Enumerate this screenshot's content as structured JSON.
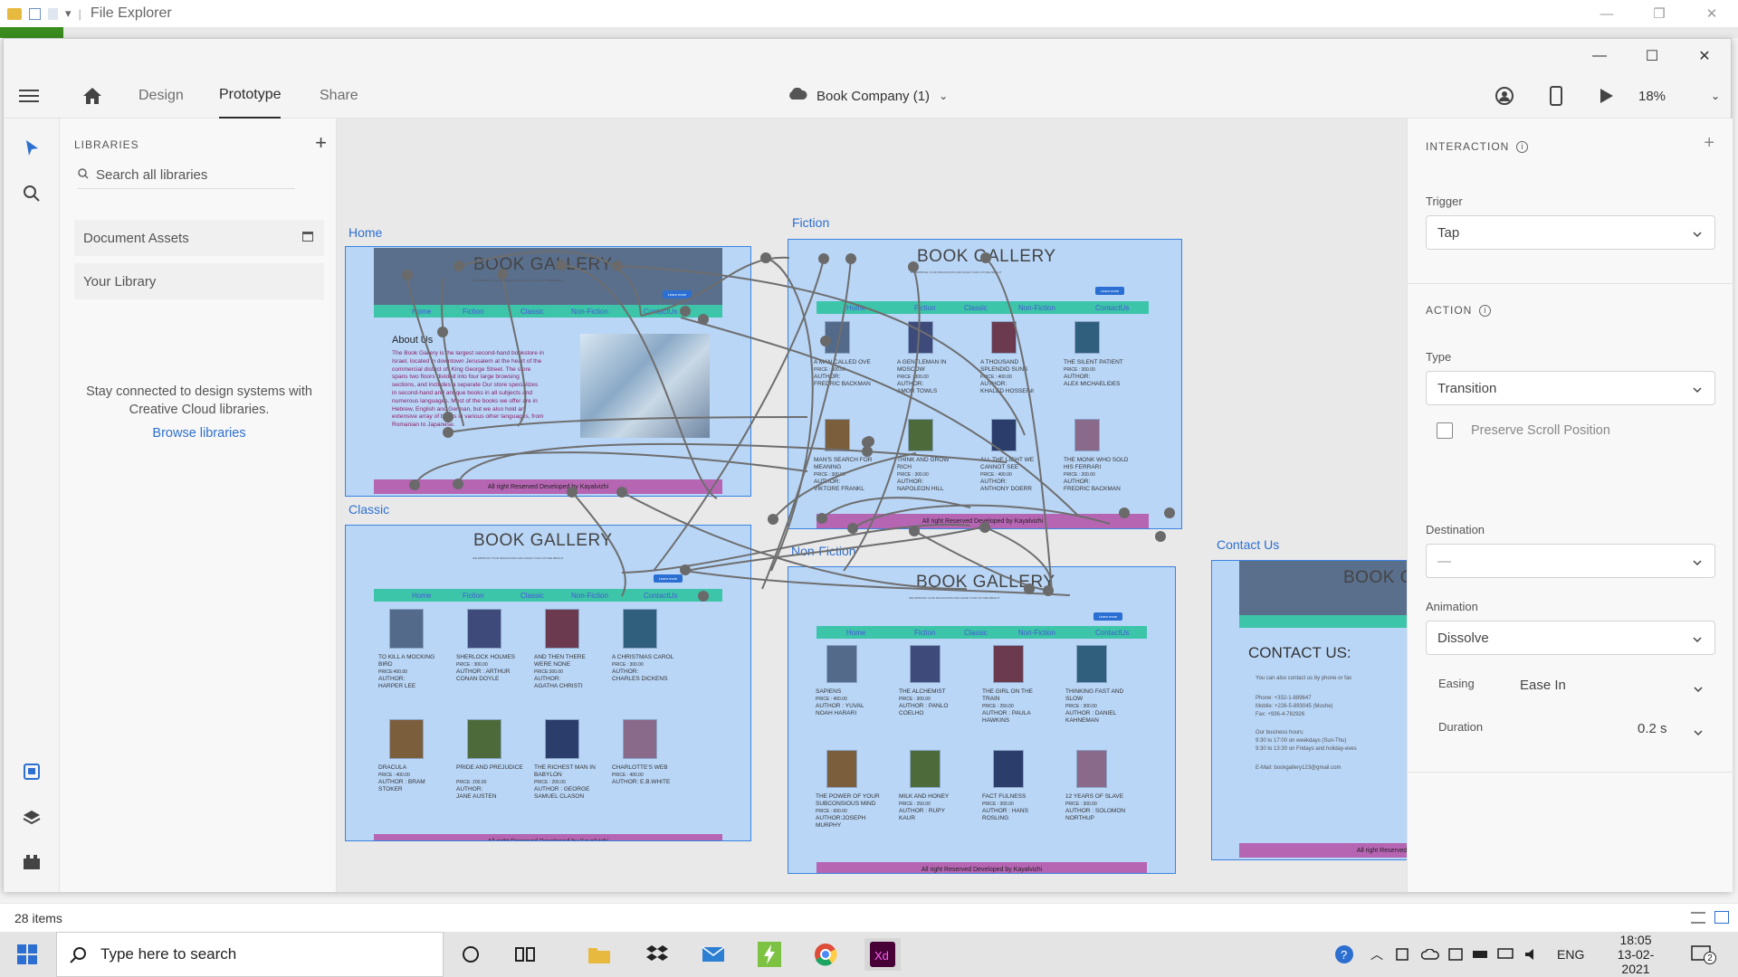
{
  "file_explorer": {
    "title": "File Explorer"
  },
  "xd": {
    "tabs": [
      "Design",
      "Prototype",
      "Share"
    ],
    "active_tab": "Prototype",
    "doc_title": "Book Company (1)",
    "zoom": "18%"
  },
  "libraries": {
    "header": "LIBRARIES",
    "search_placeholder": "Search all libraries",
    "items": [
      "Document Assets",
      "Your Library"
    ],
    "message": "Stay connected to design systems with Creative Cloud libraries.",
    "link": "Browse libraries"
  },
  "canvas": {
    "artboards": {
      "home": "Home",
      "fiction": "Fiction",
      "classic": "Classic",
      "nonfiction": "Non-Fiction",
      "contact": "Contact Us"
    },
    "gallery_title": "BOOK GALLERY",
    "tagline": "WE IMPROVE YOUR IMAGINATION AND MAKE YOUR FUTURE BRIGHT",
    "learn_more": "Learn more",
    "nav": [
      "Home",
      "Fiction",
      "Classic",
      "Non-Fiction",
      "ContactUs"
    ],
    "footer": "All right Reserved Developed by Kayalvizhi",
    "about_title": "About Us",
    "about_text": "The Book Gallery is the largest second-hand bookstore in Israel, located in downtown Jerusalem at the heart of the commercial district off King George Street. The store spans two floors divided into four large browsing sections, and includes a separate Our store specializes in second-hand and antique books in all subjects and numerous languages. Most of the books we offer are in Hebrew, English and German, but we also hold an extensive array of books in various other languages, from Romanian to Japanese.",
    "fiction_books": [
      {
        "title": "A MAN CALLED OVE",
        "price": "PRICE : 300.00",
        "author": "AUTHOR:",
        "name": "FREDRIC BACKMAN"
      },
      {
        "title": "A GENTLEMAN IN MOSCOW",
        "price": "PRICE : 300.00",
        "author": "AUTHOR:",
        "name": "AMOR TOWLS"
      },
      {
        "title": "A THOUSAND SPLENDID SUNS",
        "price": "PRICE : 400.00",
        "author": "AUTHOR:",
        "name": "KHALED HOSSEINI"
      },
      {
        "title": "THE SILENT PATIENT",
        "price": "PRICE : 300.00",
        "author": "AUTHOR:",
        "name": "ALEX MICHAELIDES"
      },
      {
        "title": "MAN'S SEARCH FOR MEANING",
        "price": "PRICE : 300.00",
        "author": "AUTHOR:",
        "name": "VIKTORE FRANKL"
      },
      {
        "title": "THINK AND GROW RICH",
        "price": "PRICE : 300.00",
        "author": "AUTHOR:",
        "name": "NAPOLEON HILL"
      },
      {
        "title": "ALL THE LIGHT WE CANNOT SEE",
        "price": "PRICE : 400.00",
        "author": "AUTHOR:",
        "name": "ANTHONY DOERR"
      },
      {
        "title": "THE MONK WHO SOLD HIS FERRARI",
        "price": "PRICE : 200.00",
        "author": "AUTHOR:",
        "name": "FREDRIC BACKMAN"
      }
    ],
    "classic_books": [
      {
        "title": "TO KILL A MOCKING BIRD",
        "price": "PRICE:400.00",
        "author": "AUTHOR:",
        "name": "HARPER LEE"
      },
      {
        "title": "SHERLOCK HOLMES",
        "price": "PRICE : 300.00",
        "author": "AUTHOR : ARTHUR",
        "name": "CONAN DOYLE"
      },
      {
        "title": "AND THEN THERE WERE NONE",
        "price": "PRICE:300.00",
        "author": "AUTHOR:",
        "name": "AGATHA CHRISTI"
      },
      {
        "title": "A CHRISTMAS CAROL",
        "price": "PRICE : 300.00",
        "author": "AUTHOR:",
        "name": "CHARLES DICKENS"
      },
      {
        "title": "DRACULA",
        "price": "PRICE : 400.00",
        "author": "AUTHOR : BRAM",
        "name": "STOKER"
      },
      {
        "title": "PRIDE AND PREJUDICE",
        "price": "PRICE: 200.00",
        "author": "AUTHOR:",
        "name": "JANE AUSTEN"
      },
      {
        "title": "THE RICHEST MAN IN BABYLON",
        "price": "PRICE : 200.00",
        "author": "AUTHOR : GEORGE",
        "name": "SAMUEL CLASON"
      },
      {
        "title": "CHARLOTTE'S WEB",
        "price": "PRICE : 400.00",
        "author": "AUTHOR: E.B.WHITE",
        "name": ""
      }
    ],
    "nonfiction_books": [
      {
        "title": "SAPIENS",
        "price": "PRICE : 400.00",
        "author": "AUTHOR : YUVAL",
        "name": "NOAH HARARI"
      },
      {
        "title": "THE ALCHEMIST",
        "price": "PRICE : 300.00",
        "author": "AUTHOR : PANLO",
        "name": "COELHO"
      },
      {
        "title": "THE GIRL ON THE TRAIN",
        "price": "PRICE : 250.00",
        "author": "AUTHOR : PAULA",
        "name": "HAWKINS"
      },
      {
        "title": "THINKING FAST AND SLOW",
        "price": "PRICE : 300.00",
        "author": "AUTHOR : DANIEL",
        "name": "KAHNEMAN"
      },
      {
        "title": "THE POWER OF YOUR SUBCONSIOUS MIND",
        "price": "PRICE : 600.00",
        "author": "AUTHOR:JOSEPH",
        "name": "MURPHY"
      },
      {
        "title": "MILK AND HONEY",
        "price": "PRICE : 250.00",
        "author": "AUTHOR : RUPY",
        "name": "KAUR"
      },
      {
        "title": "FACT FULNESS",
        "price": "PRICE : 300.00",
        "author": "AUTHOR : HANS",
        "name": "ROSLING"
      },
      {
        "title": "12 YEARS OF SLAVE",
        "price": "PRICE : 300.00",
        "author": "AUTHOR : SOLOMON",
        "name": "NORTHUP"
      }
    ],
    "contact_heading": "CONTACT US:",
    "contact_lines": [
      "You can also contact us by phone or fax",
      "Phone: +332-1-889647",
      "Mobile: +226-5-893045 (Moshe)",
      "Fax: +936-4-782926",
      "Our business hours:",
      "9:30 to 17:00 on weekdays (Sun-Thu)",
      "9:30 to 13:30 on Fridays and holiday-eves",
      "E-Mail: bookgallery123@gmail.com"
    ],
    "contact_footer": "All right Reserved De"
  },
  "properties": {
    "interaction_header": "INTERACTION",
    "trigger_label": "Trigger",
    "trigger_value": "Tap",
    "action_header": "ACTION",
    "type_label": "Type",
    "type_value": "Transition",
    "preserve_scroll": "Preserve Scroll Position",
    "destination_label": "Destination",
    "destination_value": "—",
    "animation_label": "Animation",
    "animation_value": "Dissolve",
    "easing_label": "Easing",
    "easing_value": "Ease In",
    "duration_label": "Duration",
    "duration_value": "0.2 s"
  },
  "status": {
    "items": "28 items"
  },
  "taskbar": {
    "search_placeholder": "Type here to search",
    "language": "ENG",
    "time": "18:05",
    "date": "13-02-2021",
    "notifications": "2"
  }
}
